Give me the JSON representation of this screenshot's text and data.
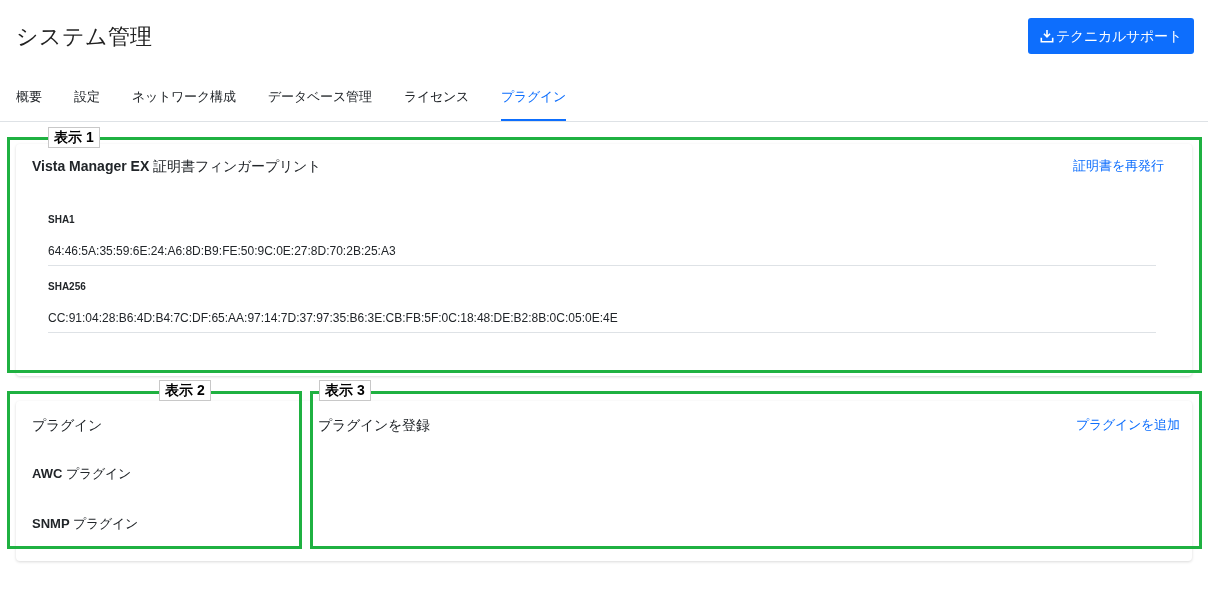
{
  "page_title": "システム管理",
  "support_button": "テクニカルサポート",
  "tabs": [
    {
      "label": "概要",
      "selected": false
    },
    {
      "label": "設定",
      "selected": false
    },
    {
      "label": "ネットワーク構成",
      "selected": false
    },
    {
      "label": "データベース管理",
      "selected": false
    },
    {
      "label": "ライセンス",
      "selected": false
    },
    {
      "label": "プラグイン",
      "selected": true
    }
  ],
  "fingerprint_card": {
    "title": "**Vista Manager EX** 証明書フィンガープリント",
    "reissue_link": "証明書を再発行",
    "fields": [
      {
        "label": "SHA1",
        "value": "64:46:5A:35:59:6E:24:A6:8D:B9:FE:50:9C:0E:27:8D:70:2B:25:A3"
      },
      {
        "label": "SHA256",
        "value": "CC:91:04:28:B6:4D:B4:7C:DF:65:AA:97:14:7D:37:97:35:B6:3E:CB:FB:5F:0C:18:48:DE:B2:8B:0C:05:0E:4E"
      }
    ]
  },
  "plugins_panel": {
    "title": "プラグイン",
    "items": [
      "**AWC** プラグイン",
      "**SNMP** プラグイン"
    ]
  },
  "register_panel": {
    "title": "プラグインを登録",
    "add_link": "プラグインを追加"
  },
  "annotations": [
    {
      "label": "表示 1"
    },
    {
      "label": "表示 2"
    },
    {
      "label": "表示 3"
    }
  ]
}
